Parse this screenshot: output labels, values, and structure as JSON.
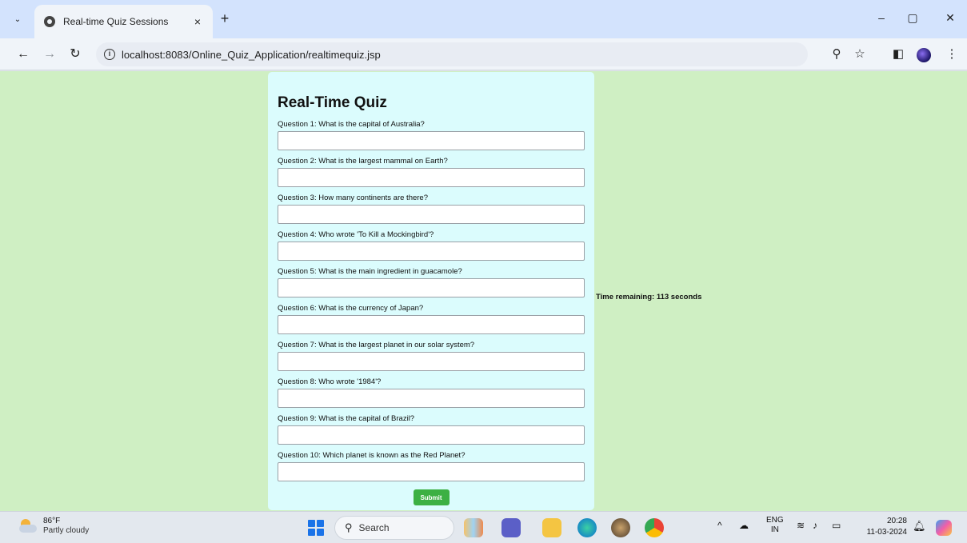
{
  "browser": {
    "tab_title": "Real-time Quiz Sessions",
    "tab_close": "×",
    "new_tab": "+",
    "url": "localhost:8083/Online_Quiz_Application/realtimequiz.jsp",
    "min": "–",
    "restore": "▢",
    "close": "✕",
    "back": "←",
    "forward": "→",
    "reload": "↻",
    "tab_search": "⌄"
  },
  "quiz": {
    "title": "Real-Time Quiz",
    "questions": [
      {
        "label": "Question 1: What is the capital of Australia?",
        "value": ""
      },
      {
        "label": "Question 2: What is the largest mammal on Earth?",
        "value": ""
      },
      {
        "label": "Question 3: How many continents are there?",
        "value": ""
      },
      {
        "label": "Question 4: Who wrote 'To Kill a Mockingbird'?",
        "value": ""
      },
      {
        "label": "Question 5: What is the main ingredient in guacamole?",
        "value": ""
      },
      {
        "label": "Question 6: What is the currency of Japan?",
        "value": ""
      },
      {
        "label": "Question 7: What is the largest planet in our solar system?",
        "value": ""
      },
      {
        "label": "Question 8: Who wrote '1984'?",
        "value": ""
      },
      {
        "label": "Question 9: What is the capital of Brazil?",
        "value": ""
      },
      {
        "label": "Question 10: Which planet is known as the Red Planet?",
        "value": ""
      }
    ],
    "submit_label": "Submit",
    "timer_text": "Time remaining: 113 seconds"
  },
  "taskbar": {
    "temperature": "86°F",
    "condition": "Partly cloudy",
    "search_placeholder": "Search",
    "lang": "ENG",
    "region": "IN",
    "time": "20:28",
    "date": "11-03-2024"
  },
  "colors": {
    "page_bg": "#cfefc3",
    "panel_bg": "#dbfcfd",
    "submit_bg": "#3cb043"
  }
}
